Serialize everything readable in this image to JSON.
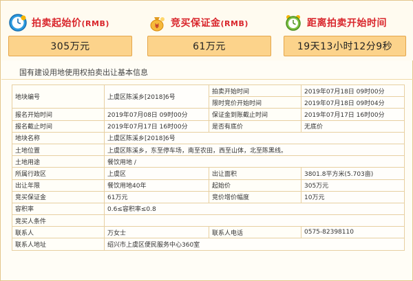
{
  "panels": [
    {
      "title": "拍卖起始价",
      "unit": "(RMB)",
      "value": "305万元",
      "icon": "clock-icon"
    },
    {
      "title": "竞买保证金",
      "unit": "(RMB)",
      "value": "61万元",
      "icon": "money-bag-icon"
    },
    {
      "title": "距离拍卖开始时间",
      "unit": "",
      "value": "19天13小时12分9秒",
      "icon": "alarm-clock-icon"
    }
  ],
  "colors": {
    "title_red": "#d9262c",
    "value_box": "#fcd38b",
    "value_border": "#e4a54a",
    "table_border": "#e7cfa0"
  },
  "section": {
    "title": "国有建设用地使用权拍卖出让基本信息"
  },
  "table": {
    "rows": [
      [
        "地块编号",
        "上虞区陈溪乡[2018]6号",
        "拍卖开始时间",
        "2019年07月18日 09时00分"
      ],
      [
        "",
        "",
        "限时竞价开始时间",
        "2019年07月18日 09时04分"
      ],
      [
        "报名开始时间",
        "2019年07月08日 09时00分",
        "保证金到账截止时间",
        "2019年07月17日 16时00分"
      ],
      [
        "报名截止时间",
        "2019年07月17日 16时00分",
        "是否有底价",
        "无底价"
      ],
      [
        "地块名称",
        "上虞区陈溪乡[2018]6号",
        "",
        ""
      ],
      [
        "土地位置",
        "上虞区陈溪乡，东至停车场，南至农田，西至山体，北至陈黑线。",
        "",
        ""
      ],
      [
        "土地用途",
        "餐饮用地 /",
        "",
        ""
      ],
      [
        "所属行政区",
        "上虞区",
        "出让面积",
        "3801.8平方米(5.703亩)"
      ],
      [
        "出让年限",
        "餐饮用地40年",
        "起始价",
        "305万元"
      ],
      [
        "竞买保证金",
        "61万元",
        "竞价增价幅度",
        "10万元"
      ],
      [
        "容积率",
        "0.6≤容积率≤0.8",
        "",
        ""
      ],
      [
        "竞买人条件",
        "",
        "",
        ""
      ],
      [
        "联系人",
        "万女士",
        "联系人电话",
        "0575-82398110"
      ],
      [
        "联系人地址",
        "绍兴市上虞区便民服务中心360室",
        "",
        ""
      ]
    ]
  }
}
